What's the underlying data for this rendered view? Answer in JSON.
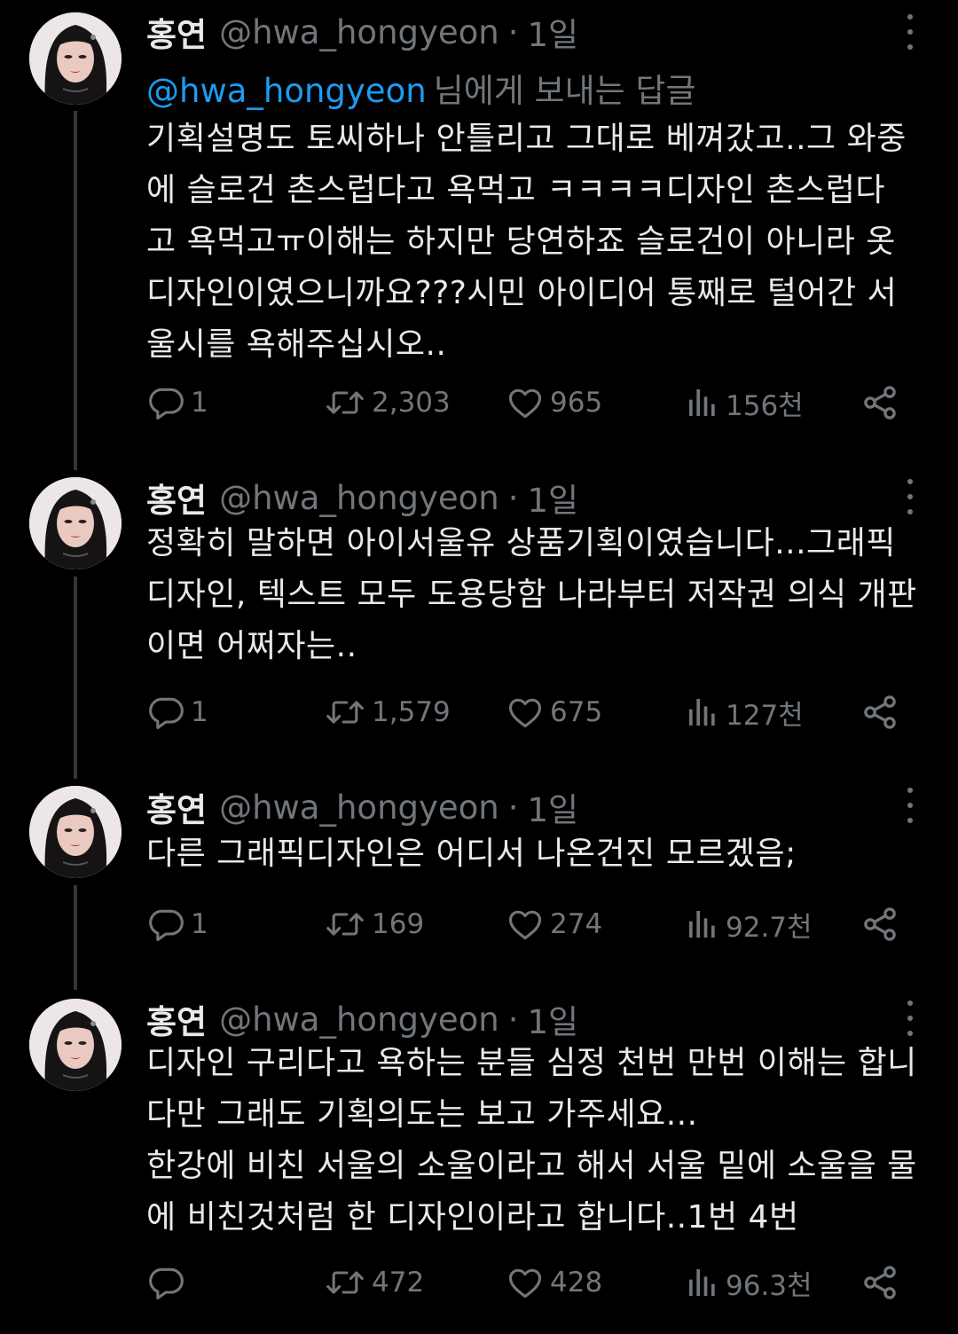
{
  "reply_to": {
    "mention": "@hwa_hongyeon",
    "suffix": "님에게 보내는 답글"
  },
  "tweets": [
    {
      "name": "홍연",
      "handle": "@hwa_hongyeon",
      "separator": "·",
      "time": "1일",
      "text": "기획설명도 토씨하나 안틀리고 그대로 베껴갔고..그 와중\n에 슬로건 촌스럽다고 욕먹고 ㅋㅋㅋㅋ디자인 촌스럽다\n고 욕먹고ㅠ이해는 하지만 당연하죠 슬로건이 아니라 옷\n디자인이였으니까요???시민 아이디어 통째로 털어간 서\n울시를 욕해주십시오..",
      "replies": "1",
      "retweets": "2,303",
      "likes": "965",
      "views": "156천"
    },
    {
      "name": "홍연",
      "handle": "@hwa_hongyeon",
      "separator": "·",
      "time": "1일",
      "text": "정확히 말하면 아이서울유 상품기획이였습니다...그래픽\n디자인, 텍스트 모두 도용당함 나라부터 저작권 의식 개판\n이면 어쩌자는..",
      "replies": "1",
      "retweets": "1,579",
      "likes": "675",
      "views": "127천"
    },
    {
      "name": "홍연",
      "handle": "@hwa_hongyeon",
      "separator": "·",
      "time": "1일",
      "text": "다른 그래픽디자인은 어디서 나온건진 모르겠음;",
      "replies": "1",
      "retweets": "169",
      "likes": "274",
      "views": "92.7천"
    },
    {
      "name": "홍연",
      "handle": "@hwa_hongyeon",
      "separator": "·",
      "time": "1일",
      "text": "디자인 구리다고 욕하는 분들 심정 천번 만번 이해는 합니\n다만 그래도 기획의도는 보고 가주세요...\n한강에 비친 서울의 소울이라고 해서 서울 밑에 소울을 물\n에 비친것처럼 한 디자인이라고 합니다..1번 4번",
      "replies": "",
      "retweets": "472",
      "likes": "428",
      "views": "96.3천"
    }
  ],
  "icons": {
    "reply": "reply-icon",
    "retweet": "retweet-icon",
    "like": "heart-icon",
    "views": "views-icon",
    "share": "share-icon",
    "more": "more-dots-icon"
  },
  "colors": {
    "background": "#000000",
    "text": "#e7e9ea",
    "secondary": "#71767b",
    "mention": "#1d9bf0",
    "thread_line": "#333639"
  }
}
